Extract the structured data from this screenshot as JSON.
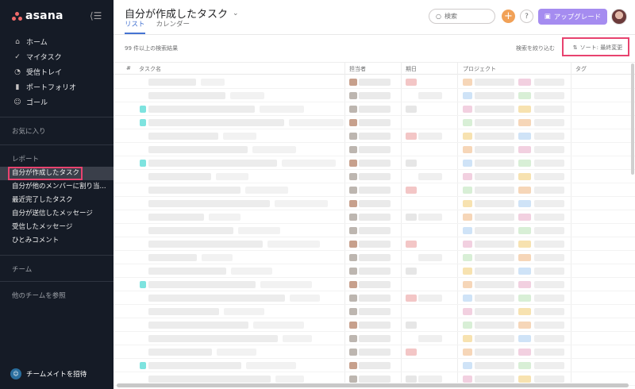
{
  "sidebar": {
    "logo_text": "asana",
    "nav": [
      {
        "label": "ホーム",
        "icon": "⌂",
        "icon_name": "home-icon"
      },
      {
        "label": "マイタスク",
        "icon": "✓",
        "icon_name": "check-circle-icon"
      },
      {
        "label": "受信トレイ",
        "icon": "🔔",
        "icon_name": "bell-icon"
      },
      {
        "label": "ポートフォリオ",
        "icon": "▮",
        "icon_name": "bar-chart-icon"
      },
      {
        "label": "ゴール",
        "icon": "⚇",
        "icon_name": "person-icon"
      }
    ],
    "favorites_label": "お気に入り",
    "reports_label": "レポート",
    "reports": [
      "自分が作成したタスク",
      "自分が他のメンバーに割り当...",
      "最近完了したタスク",
      "自分が送信したメッセージ",
      "受信したメッセージ",
      "ひとみコメント"
    ],
    "team_label": "チーム",
    "browse_teams_label": "他のチームを参照",
    "invite_label": "チームメイトを招待"
  },
  "header": {
    "title": "自分が作成したタスク",
    "tabs": [
      "リスト",
      "カレンダー"
    ],
    "search_placeholder": "検索",
    "upgrade_label": "アップグレード",
    "help_label": "?",
    "add_label": "+"
  },
  "toolbar": {
    "results_text": "99 件以上の検索結果",
    "refine_label": "検索を絞り込む",
    "sort_label": "ソート: 最終変更"
  },
  "table": {
    "columns": [
      "#",
      "タスク名",
      "担当者",
      "期日",
      "プロジェクト",
      "タグ"
    ]
  },
  "colors": {
    "sidebar_bg": "#151b26",
    "accent": "#4573d2",
    "highlight": "#e8436f",
    "upgrade": "#a58cf0",
    "add_button": "#f1a157"
  }
}
